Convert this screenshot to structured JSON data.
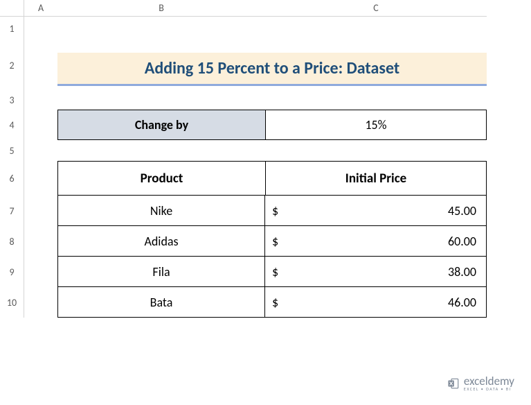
{
  "columns": {
    "a": "A",
    "b": "B",
    "c": "C"
  },
  "rows": [
    "1",
    "2",
    "3",
    "4",
    "5",
    "6",
    "7",
    "8",
    "9",
    "10"
  ],
  "title": "Adding 15 Percent to a Price: Dataset",
  "changeby": {
    "label": "Change by",
    "value": "15%"
  },
  "table": {
    "headers": {
      "product": "Product",
      "price": "Initial Price"
    },
    "rows": [
      {
        "product": "Nike",
        "currency": "$",
        "price": "45.00"
      },
      {
        "product": "Adidas",
        "currency": "$",
        "price": "60.00"
      },
      {
        "product": "Fila",
        "currency": "$",
        "price": "38.00"
      },
      {
        "product": "Bata",
        "currency": "$",
        "price": "46.00"
      }
    ]
  },
  "watermark": {
    "brand": "exceldemy",
    "tagline": "EXCEL • DATA • BI"
  },
  "chart_data": {
    "type": "table",
    "title": "Adding 15 Percent to a Price: Dataset",
    "parameters": {
      "Change by": "15%"
    },
    "columns": [
      "Product",
      "Initial Price"
    ],
    "rows": [
      [
        "Nike",
        45.0
      ],
      [
        "Adidas",
        60.0
      ],
      [
        "Fila",
        38.0
      ],
      [
        "Bata",
        46.0
      ]
    ],
    "currency": "$"
  }
}
